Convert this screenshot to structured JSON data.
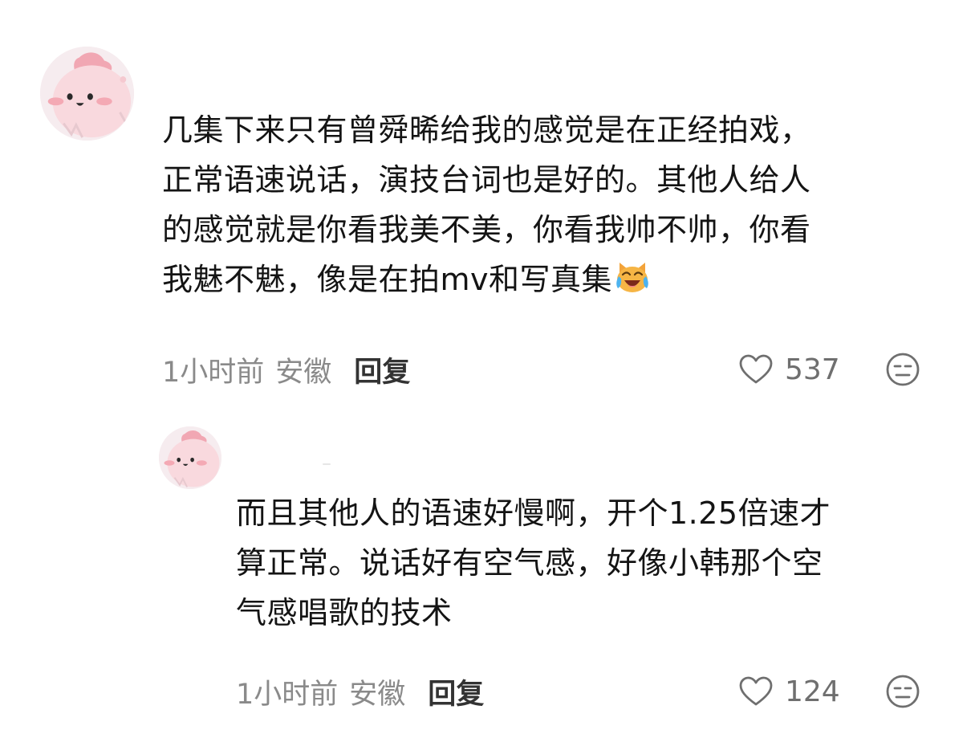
{
  "comments": [
    {
      "avatar_icon": "pink-blob-avatar-icon",
      "text": "几集下来只有曾舜晞给我的感觉是在正经拍戏，\n正常语速说话，演技台词也是好的。其他人给人\n的感觉就是你看我美不美，你看我帅不帅，你看\n我魅不魅，像是在拍mv和写真集",
      "emoji": "laughing-crying-cat-emoji",
      "time": "1小时前",
      "location": "安徽",
      "reply_label": "回复",
      "likes": "537",
      "like_icon": "heart-icon",
      "dislike_icon": "meh-face-icon",
      "replies": [
        {
          "avatar_icon": "pink-blob-avatar-icon",
          "text": "而且其他人的语速好慢啊，开个1.25倍速才\n算正常。说话好有空气感，好像小韩那个空\n气感唱歌的技术",
          "time": "1小时前",
          "location": "安徽",
          "reply_label": "回复",
          "likes": "124",
          "like_icon": "heart-icon",
          "dislike_icon": "meh-face-icon"
        }
      ]
    }
  ],
  "colors": {
    "text": "#141414",
    "meta": "#8a8a8a",
    "reply": "#333333",
    "icon": "#6f6f6f",
    "avatar_bg": "#f6ecef",
    "avatar_blob": "#f8d3d9",
    "avatar_cheek": "#f4a9b4"
  }
}
